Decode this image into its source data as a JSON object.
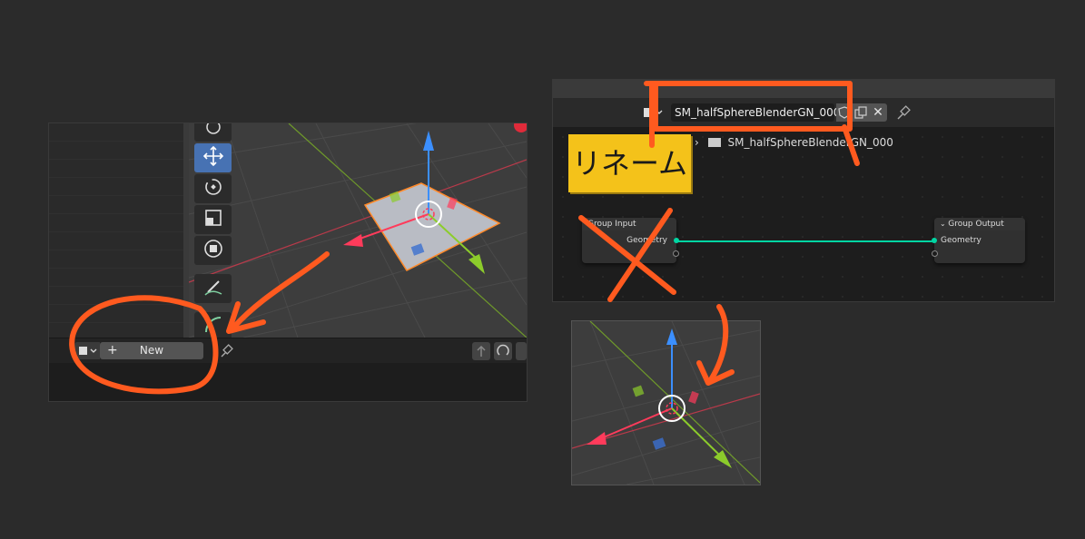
{
  "left_panel": {
    "new_button_label": "New",
    "plus_glyph": "+",
    "icons": [
      "node-tree-type-icon",
      "pin-icon",
      "move-tool-icon",
      "rotate-tool-icon",
      "scale-tool-icon",
      "transform-tool-icon",
      "annotate-tool-icon",
      "measure-tool-icon"
    ]
  },
  "node_editor": {
    "node_group_name": "SM_halfSphereBlenderGN_000",
    "breadcrumb_name": "SM_halfSphereBlenderGN_000",
    "close_glyph": "✕",
    "nodes": [
      {
        "title": "Group Input",
        "output_socket": "Geometry"
      },
      {
        "title": "Group Output",
        "input_socket": "Geometry"
      }
    ]
  },
  "annotation": {
    "rename_label": "リネーム",
    "accent_color": "#ff5a1f",
    "label_color": "#f4c21a"
  },
  "colors": {
    "active_tool": "#4772b3",
    "geometry_link": "#00d6a3",
    "axis_x": "#ff3b5b",
    "axis_y": "#8ccc2b",
    "axis_z": "#3b8fff"
  }
}
